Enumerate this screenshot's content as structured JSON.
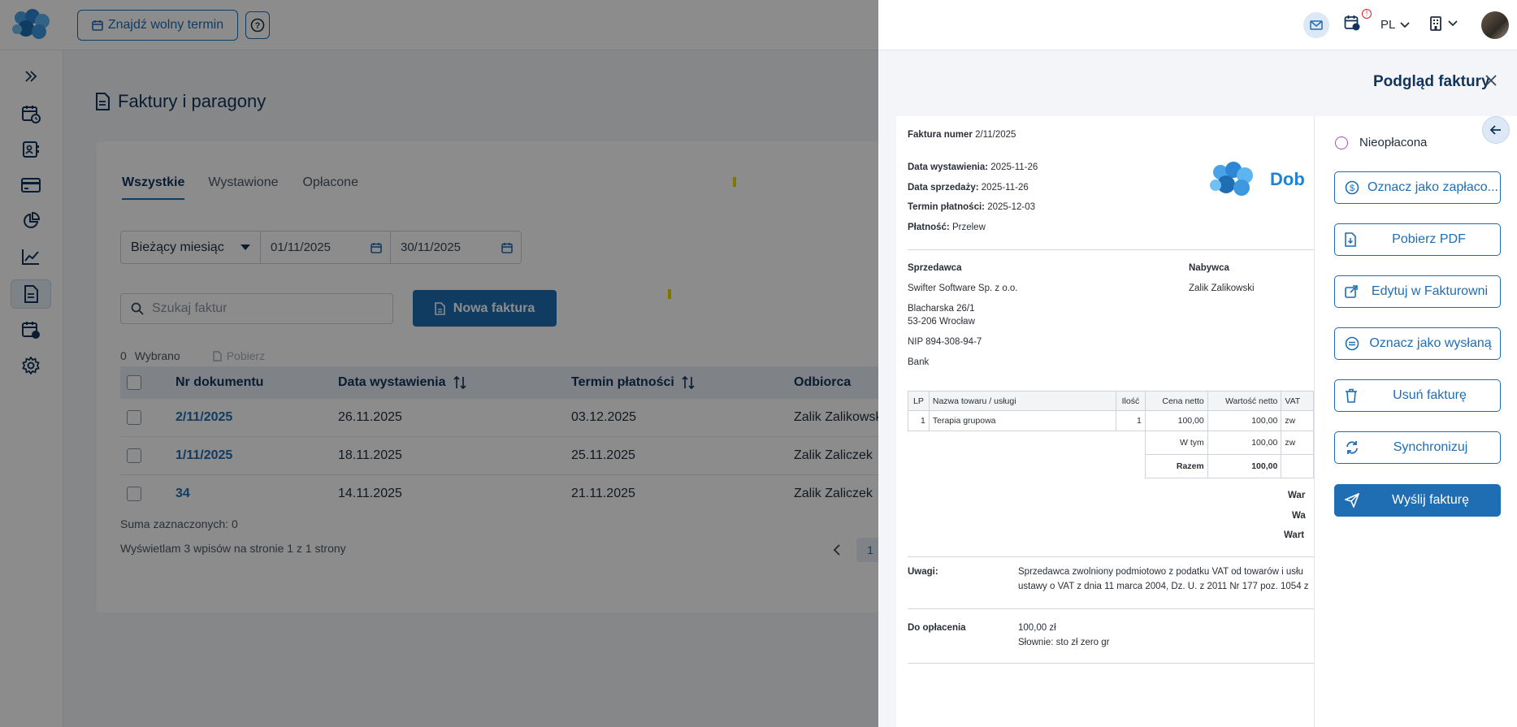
{
  "topbar": {
    "find_slot_label": "Znajdź wolny termin",
    "lang": "PL",
    "notification_badge": "!"
  },
  "page": {
    "title": "Faktury i paragony",
    "tabs": [
      "Wszystkie",
      "Wystawione",
      "Opłacone"
    ],
    "active_tab": "Wszystkie",
    "filters": {
      "period": "Bieżący miesiąc",
      "date_from": "01/11/2025",
      "date_to": "30/11/2025"
    },
    "search_placeholder": "Szukaj faktur",
    "new_invoice_label": "Nowa faktura",
    "selected_count": "0",
    "selected_label": "Wybrano",
    "download_label": "Pobierz",
    "table": {
      "headers": [
        "Nr dokumentu",
        "Data wystawienia",
        "Termin płatności",
        "Odbiorca"
      ],
      "rows": [
        {
          "nr": "2/11/2025",
          "issued": "26.11.2025",
          "due": "03.12.2025",
          "recipient": "Zalik Zalikowski"
        },
        {
          "nr": "1/11/2025",
          "issued": "18.11.2025",
          "due": "25.11.2025",
          "recipient": "Zalik Zaliczek"
        },
        {
          "nr": "34",
          "issued": "14.11.2025",
          "due": "21.11.2025",
          "recipient": "Zalik Zaliczek"
        }
      ]
    },
    "sum_selected": "Suma zaznaczonych: 0",
    "showing": "Wyświetlam 3 wpisów na stronie 1 z 1 strony",
    "current_page": "1"
  },
  "panel": {
    "title": "Podgląd faktury",
    "status": "Nieopłacona",
    "actions": [
      "Oznacz jako zapłaco...",
      "Pobierz PDF",
      "Edytuj w Fakturowni",
      "Oznacz jako wysłaną",
      "Usuń fakturę",
      "Synchronizuj",
      "Wyślij fakturę"
    ]
  },
  "invoice": {
    "number_label": "Faktura numer",
    "number": "2/11/2025",
    "issue_label": "Data wystawienia:",
    "issue": "2025-11-26",
    "sale_label": "Data sprzedaży:",
    "sale": "2025-11-26",
    "due_label": "Termin płatności:",
    "due": "2025-12-03",
    "payment_label": "Płatność:",
    "payment": "Przelew",
    "brand": "Dob",
    "seller_label": "Sprzedawca",
    "seller_name": "Swifter Software Sp. z o.o.",
    "seller_street": "Blacharska 26/1",
    "seller_city": "53-206 Wrocław",
    "seller_nip": "NIP 894-308-94-7",
    "seller_bank": "Bank",
    "buyer_label": "Nabywca",
    "buyer_name": "Zalik Zalikowski",
    "table_headers": [
      "LP",
      "Nazwa towaru / usługi",
      "Ilość",
      "Cena netto",
      "Wartość netto",
      "VAT"
    ],
    "item": {
      "lp": "1",
      "name": "Terapia grupowa",
      "qty": "1",
      "price": "100,00",
      "net": "100,00",
      "vat": "zw"
    },
    "wtym_label": "W tym",
    "wtym_net": "100,00",
    "wtym_vat": "zw",
    "razem_label": "Razem",
    "razem_net": "100,00",
    "summary_cut": [
      "War",
      "Wa",
      "Wart"
    ],
    "notes_label": "Uwagi:",
    "notes_line1": "Sprzedawca zwolniony podmiotowo z podatku VAT od towarów i usłu",
    "notes_line2": "ustawy o VAT z dnia 11 marca 2004, Dz. U. z 2011 Nr 177 poz. 1054 z",
    "topay_label": "Do opłacenia",
    "topay_amount": "100,00 zł",
    "topay_words": "Słownie: sto zł zero gr"
  }
}
